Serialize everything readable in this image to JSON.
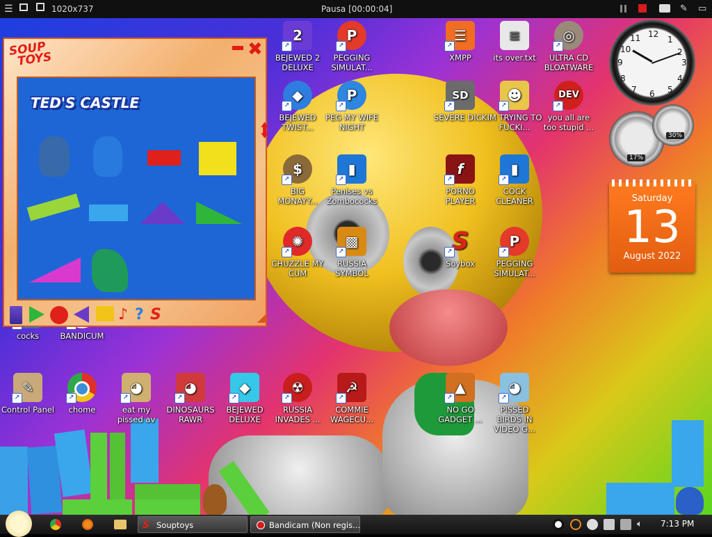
{
  "recorder_bar": {
    "resolution": "1020x737",
    "status": "Pausa [00:00:04]"
  },
  "desktop_icons": [
    {
      "id": "bejewed2",
      "label": "BEJEWED 2 DELUXE",
      "color": "#6b3bd6",
      "glyph": "2"
    },
    {
      "id": "pegging1",
      "label": "PEGGING SIMULAT...",
      "color": "#e43a2a",
      "glyph": "P"
    },
    {
      "id": "xmpp",
      "label": "XMPP",
      "color": "#f06d22",
      "glyph": "☰"
    },
    {
      "id": "itsover",
      "label": "its over.txt",
      "color": "#e8e8e8",
      "glyph": "≡"
    },
    {
      "id": "ultracd",
      "label": "ULTRA CD BLOATWARE",
      "color": "#9a8a7a",
      "glyph": "◎"
    },
    {
      "id": "bejewedtwist",
      "label": "BEJEWED TWIST...",
      "color": "#2f7de0",
      "glyph": "◆"
    },
    {
      "id": "pegmywife",
      "label": "PEG MY WIFE NIGHT",
      "color": "#2f86e0",
      "glyph": "P"
    },
    {
      "id": "severedick",
      "label": "SEVERE DICK",
      "color": "#6b6b6b",
      "glyph": "SD"
    },
    {
      "id": "imtrying",
      "label": "IM TRYING TO FUCKI...",
      "color": "#e8c64a",
      "glyph": "☻"
    },
    {
      "id": "devcpp",
      "label": "you all are too stupid ...",
      "color": "#d0201e",
      "glyph": "DEV"
    },
    {
      "id": "bigmoney",
      "label": "BIG MONAYY...",
      "color": "#8a6a3a",
      "glyph": "$"
    },
    {
      "id": "penises",
      "label": "Penises vs Zombococks",
      "color": "#1e77d6",
      "glyph": "▮"
    },
    {
      "id": "pornoplayer",
      "label": "PORNO PLAYER",
      "color": "#8a1414",
      "glyph": "f"
    },
    {
      "id": "cockcleaner",
      "label": "COCK CLEANER",
      "color": "#1e77d6",
      "glyph": "▮"
    },
    {
      "id": "chuzzle",
      "label": "CHUZZLE MY CUM",
      "color": "#e02a2a",
      "glyph": "✺"
    },
    {
      "id": "russiasymbol",
      "label": "RUSSIA SYMBOL",
      "color": "#d98a14",
      "glyph": "▩"
    },
    {
      "id": "soybox",
      "label": "Soybox",
      "color": "#e0201a",
      "glyph": "S"
    },
    {
      "id": "pegging2",
      "label": "PEGGING SIMULAT...",
      "color": "#e43a2a",
      "glyph": "P"
    },
    {
      "id": "cocks",
      "label": "cocks",
      "color": "#1e77d6",
      "glyph": "▮"
    },
    {
      "id": "bandicum",
      "label": "BANDICUM",
      "color": "#111111",
      "glyph": "●"
    },
    {
      "id": "controlpanel",
      "label": "Control Panel",
      "color": "#c9a97a",
      "glyph": "✎"
    },
    {
      "id": "chome",
      "label": "chome",
      "color": "#3a8fd6",
      "glyph": "◉"
    },
    {
      "id": "eatmypissed",
      "label": "eat my pissed av",
      "color": "#d0b070",
      "glyph": "◕"
    },
    {
      "id": "dinosaurs",
      "label": "DINOSAURS RAWR",
      "color": "#d03a3a",
      "glyph": "◕"
    },
    {
      "id": "bejeweddeluxe",
      "label": "BEJEWED DELUXE",
      "color": "#35c8e8",
      "glyph": "◆"
    },
    {
      "id": "russiainvades",
      "label": "RUSSIA INVADES ...",
      "color": "#c81e1e",
      "glyph": "☢"
    },
    {
      "id": "commie",
      "label": "COMMIE WAGECU...",
      "color": "#b81a1a",
      "glyph": "☭"
    },
    {
      "id": "nogogadget",
      "label": "NO GO GADGET ...",
      "color": "#d07020",
      "glyph": "▲"
    },
    {
      "id": "pissedbirds",
      "label": "PISSED BIRDS IN VIDEO G...",
      "color": "#8ac0e0",
      "glyph": "◕"
    }
  ],
  "clock_widget": {
    "numbers": [
      "12",
      "1",
      "2",
      "3",
      "4",
      "5",
      "6",
      "7",
      "8",
      "9",
      "10",
      "11"
    ]
  },
  "meter_widget": {
    "cpu_percent": "17%",
    "mem_percent": "30%"
  },
  "calendar_widget": {
    "weekday": "Saturday",
    "day": "13",
    "month_year": "August 2022"
  },
  "soup_window": {
    "logo_line1": "SOUP",
    "logo_line2": "TOYS",
    "minimize_glyph": "",
    "close_glyph": "✖",
    "game_title": "TED'S CASTLE"
  },
  "taskbar": {
    "soup_task": "Souptoys",
    "bandicam_task": "Bandicam (Non regis...",
    "time": "7:13 PM"
  },
  "colors": {
    "accent_red": "#e21c14",
    "play_blue": "#1e66d6"
  }
}
